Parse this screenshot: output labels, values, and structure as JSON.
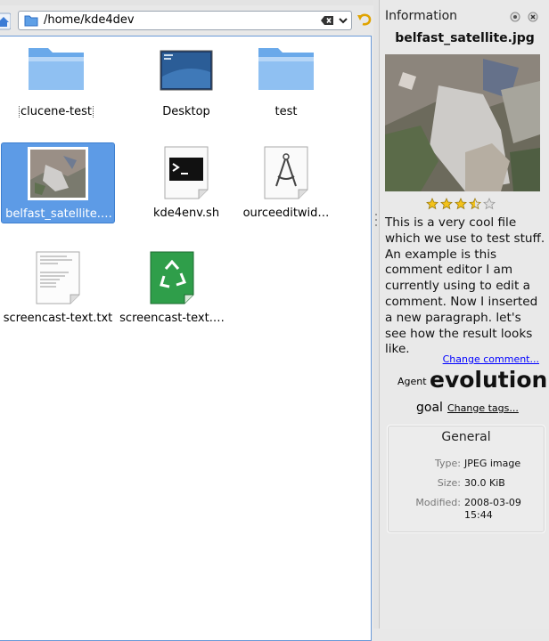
{
  "location": {
    "path": "/home/kde4dev"
  },
  "files": [
    {
      "name": "clucene-test",
      "icon": "folder-icon"
    },
    {
      "name": "Desktop",
      "icon": "desktop-folder-icon"
    },
    {
      "name": "test",
      "icon": "folder-icon"
    },
    {
      "name": "belfast_satellite.…",
      "icon": "image-thumbnail"
    },
    {
      "name": "kde4env.sh",
      "icon": "terminal-script-icon"
    },
    {
      "name": "ourceeditwid…",
      "icon": "design-compass-icon"
    },
    {
      "name": "screencast-text.txt",
      "icon": "text-file-icon"
    },
    {
      "name": "screencast-text.…",
      "icon": "recycle-icon"
    }
  ],
  "selected_file": "belfast_satellite.…",
  "info": {
    "title": "Information",
    "filename": "belfast_satellite.jpg",
    "rating": 3.5,
    "rating_max": 5,
    "comment": "This is a very cool file which we use to test stuff. An example is this comment editor I am currently using to edit a comment. Now I inserted a new paragraph. let's see how the result looks like.",
    "change_comment": "Change comment...",
    "tags": [
      "Agent",
      "evolution",
      "goal"
    ],
    "change_tags": "Change tags...",
    "general": {
      "title": "General",
      "type_label": "Type:",
      "type_value": "JPEG image",
      "size_label": "Size:",
      "size_value": "30.0 KiB",
      "modified_label": "Modified:",
      "modified_value": "2008-03-09 15:44"
    }
  },
  "colors": {
    "selection": "#5d9be6",
    "link": "#0000ff",
    "star": "#f3c21a"
  }
}
